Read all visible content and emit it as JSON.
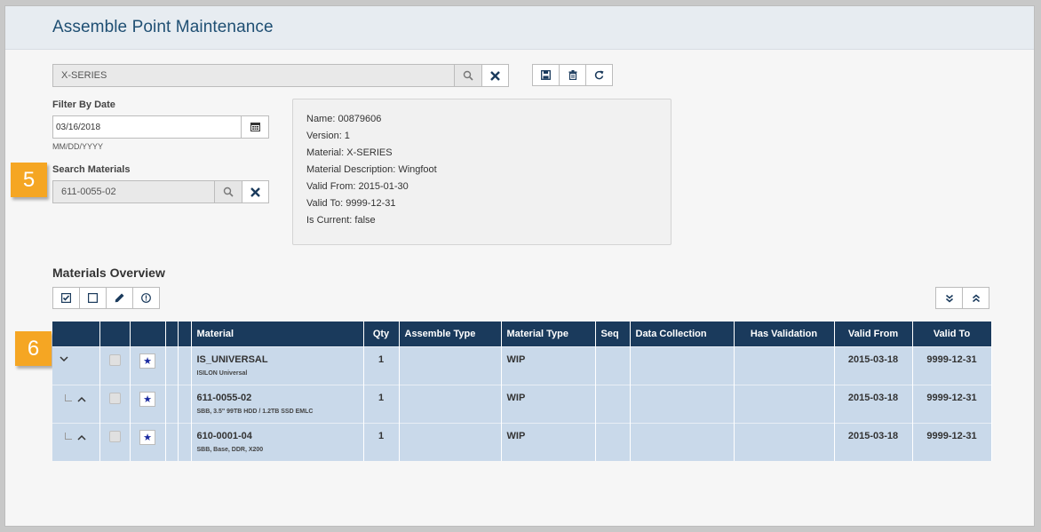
{
  "header": {
    "title": "Assemble Point Maintenance"
  },
  "search": {
    "value": "X-SERIES"
  },
  "filter": {
    "label": "Filter By Date",
    "date_value": "03/16/2018",
    "format_hint": "MM/DD/YYYY"
  },
  "search_materials": {
    "label": "Search Materials",
    "value": "611-0055-02"
  },
  "info": {
    "lines": [
      "Name:  00879606",
      "Version:  1",
      "Material:  X-SERIES",
      "Material Description:  Wingfoot",
      "Valid From:  2015-01-30",
      "Valid To:  9999-12-31",
      "Is Current:  false"
    ]
  },
  "callouts": {
    "five": "5",
    "six": "6"
  },
  "overview": {
    "title": "Materials Overview"
  },
  "table": {
    "headers": {
      "material": "Material",
      "qty": "Qty",
      "assemble_type": "Assemble Type",
      "material_type": "Material Type",
      "seq": "Seq",
      "data_collection": "Data Collection",
      "has_validation": "Has Validation",
      "valid_from": "Valid From",
      "valid_to": "Valid To"
    },
    "rows": [
      {
        "material": "IS_UNIVERSAL",
        "description": "ISILON Universal",
        "qty": "1",
        "assemble_type": "",
        "material_type": "WIP",
        "seq": "",
        "data_collection": "",
        "has_validation": "",
        "valid_from": "2015-03-18",
        "valid_to": "9999-12-31"
      },
      {
        "material": "611-0055-02",
        "description": "SBB, 3.5\" 99TB HDD / 1.2TB SSD EMLC",
        "qty": "1",
        "assemble_type": "",
        "material_type": "WIP",
        "seq": "",
        "data_collection": "",
        "has_validation": "",
        "valid_from": "2015-03-18",
        "valid_to": "9999-12-31"
      },
      {
        "material": "610-0001-04",
        "description": "SBB, Base, DDR, X200",
        "qty": "1",
        "assemble_type": "",
        "material_type": "WIP",
        "seq": "",
        "data_collection": "",
        "has_validation": "",
        "valid_from": "2015-03-18",
        "valid_to": "9999-12-31"
      }
    ]
  },
  "colors": {
    "header_bg": "#1a3a5c",
    "row_bg": "#c9d9ea",
    "accent": "#1f4f73",
    "callout": "#f5a623",
    "star": "#1a2aa0"
  }
}
